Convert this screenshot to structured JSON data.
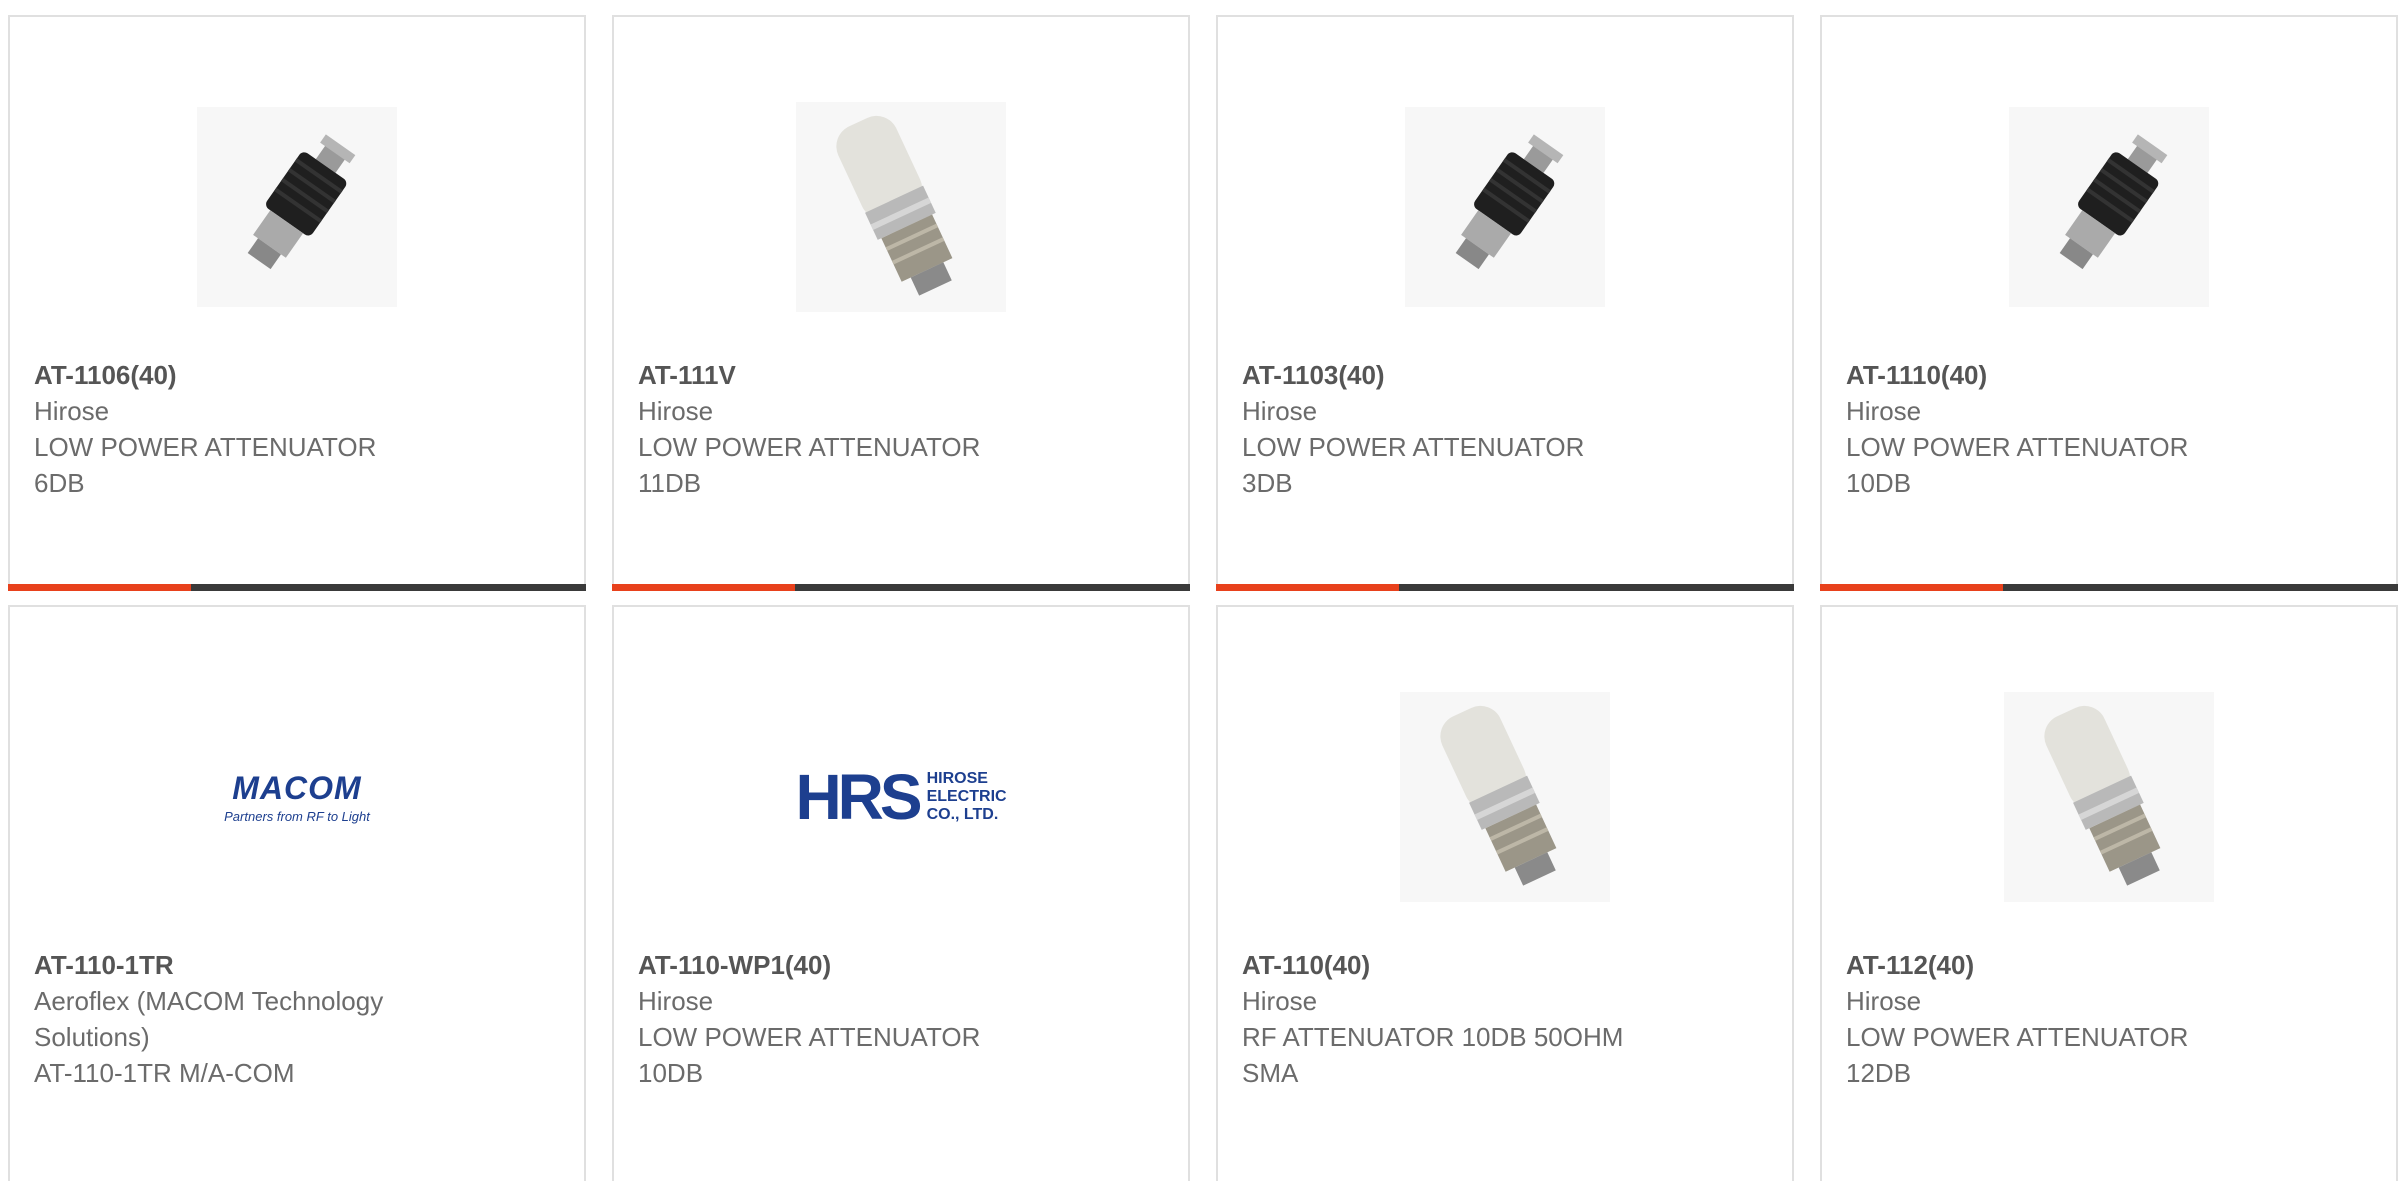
{
  "products": [
    {
      "part_number": "AT-1106(40)",
      "manufacturer": "Hirose",
      "desc1": "LOW POWER ATTENUATOR",
      "desc2": "6DB",
      "image": "attenuator-black-photo"
    },
    {
      "part_number": "AT-111V",
      "manufacturer": "Hirose",
      "desc1": "LOW POWER ATTENUATOR",
      "desc2": "11DB",
      "image": "attenuator-silver-photo"
    },
    {
      "part_number": "AT-1103(40)",
      "manufacturer": "Hirose",
      "desc1": "LOW POWER ATTENUATOR",
      "desc2": "3DB",
      "image": "attenuator-black-photo"
    },
    {
      "part_number": "AT-1110(40)",
      "manufacturer": "Hirose",
      "desc1": "LOW POWER ATTENUATOR",
      "desc2": "10DB",
      "image": "attenuator-black-photo"
    },
    {
      "part_number": "AT-110-1TR",
      "manufacturer": "Aeroflex (MACOM Technology",
      "manufacturer_cont": "Solutions)",
      "desc1": "AT-110-1TR M/A-COM",
      "desc2": "",
      "image": "macom-logo"
    },
    {
      "part_number": "AT-110-WP1(40)",
      "manufacturer": "Hirose",
      "desc1": "LOW POWER ATTENUATOR",
      "desc2": "10DB",
      "image": "hrs-logo"
    },
    {
      "part_number": "AT-110(40)",
      "manufacturer": "Hirose",
      "desc1": "RF ATTENUATOR 10DB 50OHM",
      "desc2": "SMA",
      "image": "attenuator-silver-photo"
    },
    {
      "part_number": "AT-112(40)",
      "manufacturer": "Hirose",
      "desc1": "LOW POWER ATTENUATOR",
      "desc2": "12DB",
      "image": "attenuator-silver-photo"
    }
  ],
  "logos": {
    "macom": {
      "name": "MACOM",
      "tagline": "Partners from RF to Light"
    },
    "hrs": {
      "mark": "HRS",
      "line1": "HIROSE",
      "line2": "ELECTRIC",
      "line3": "CO., LTD."
    }
  },
  "colors": {
    "accent": "#e8411c",
    "bar": "#3a3a3a",
    "text": "#6b6b6b",
    "border": "#e0e0e0",
    "logo_blue": "#1d3f8f"
  }
}
